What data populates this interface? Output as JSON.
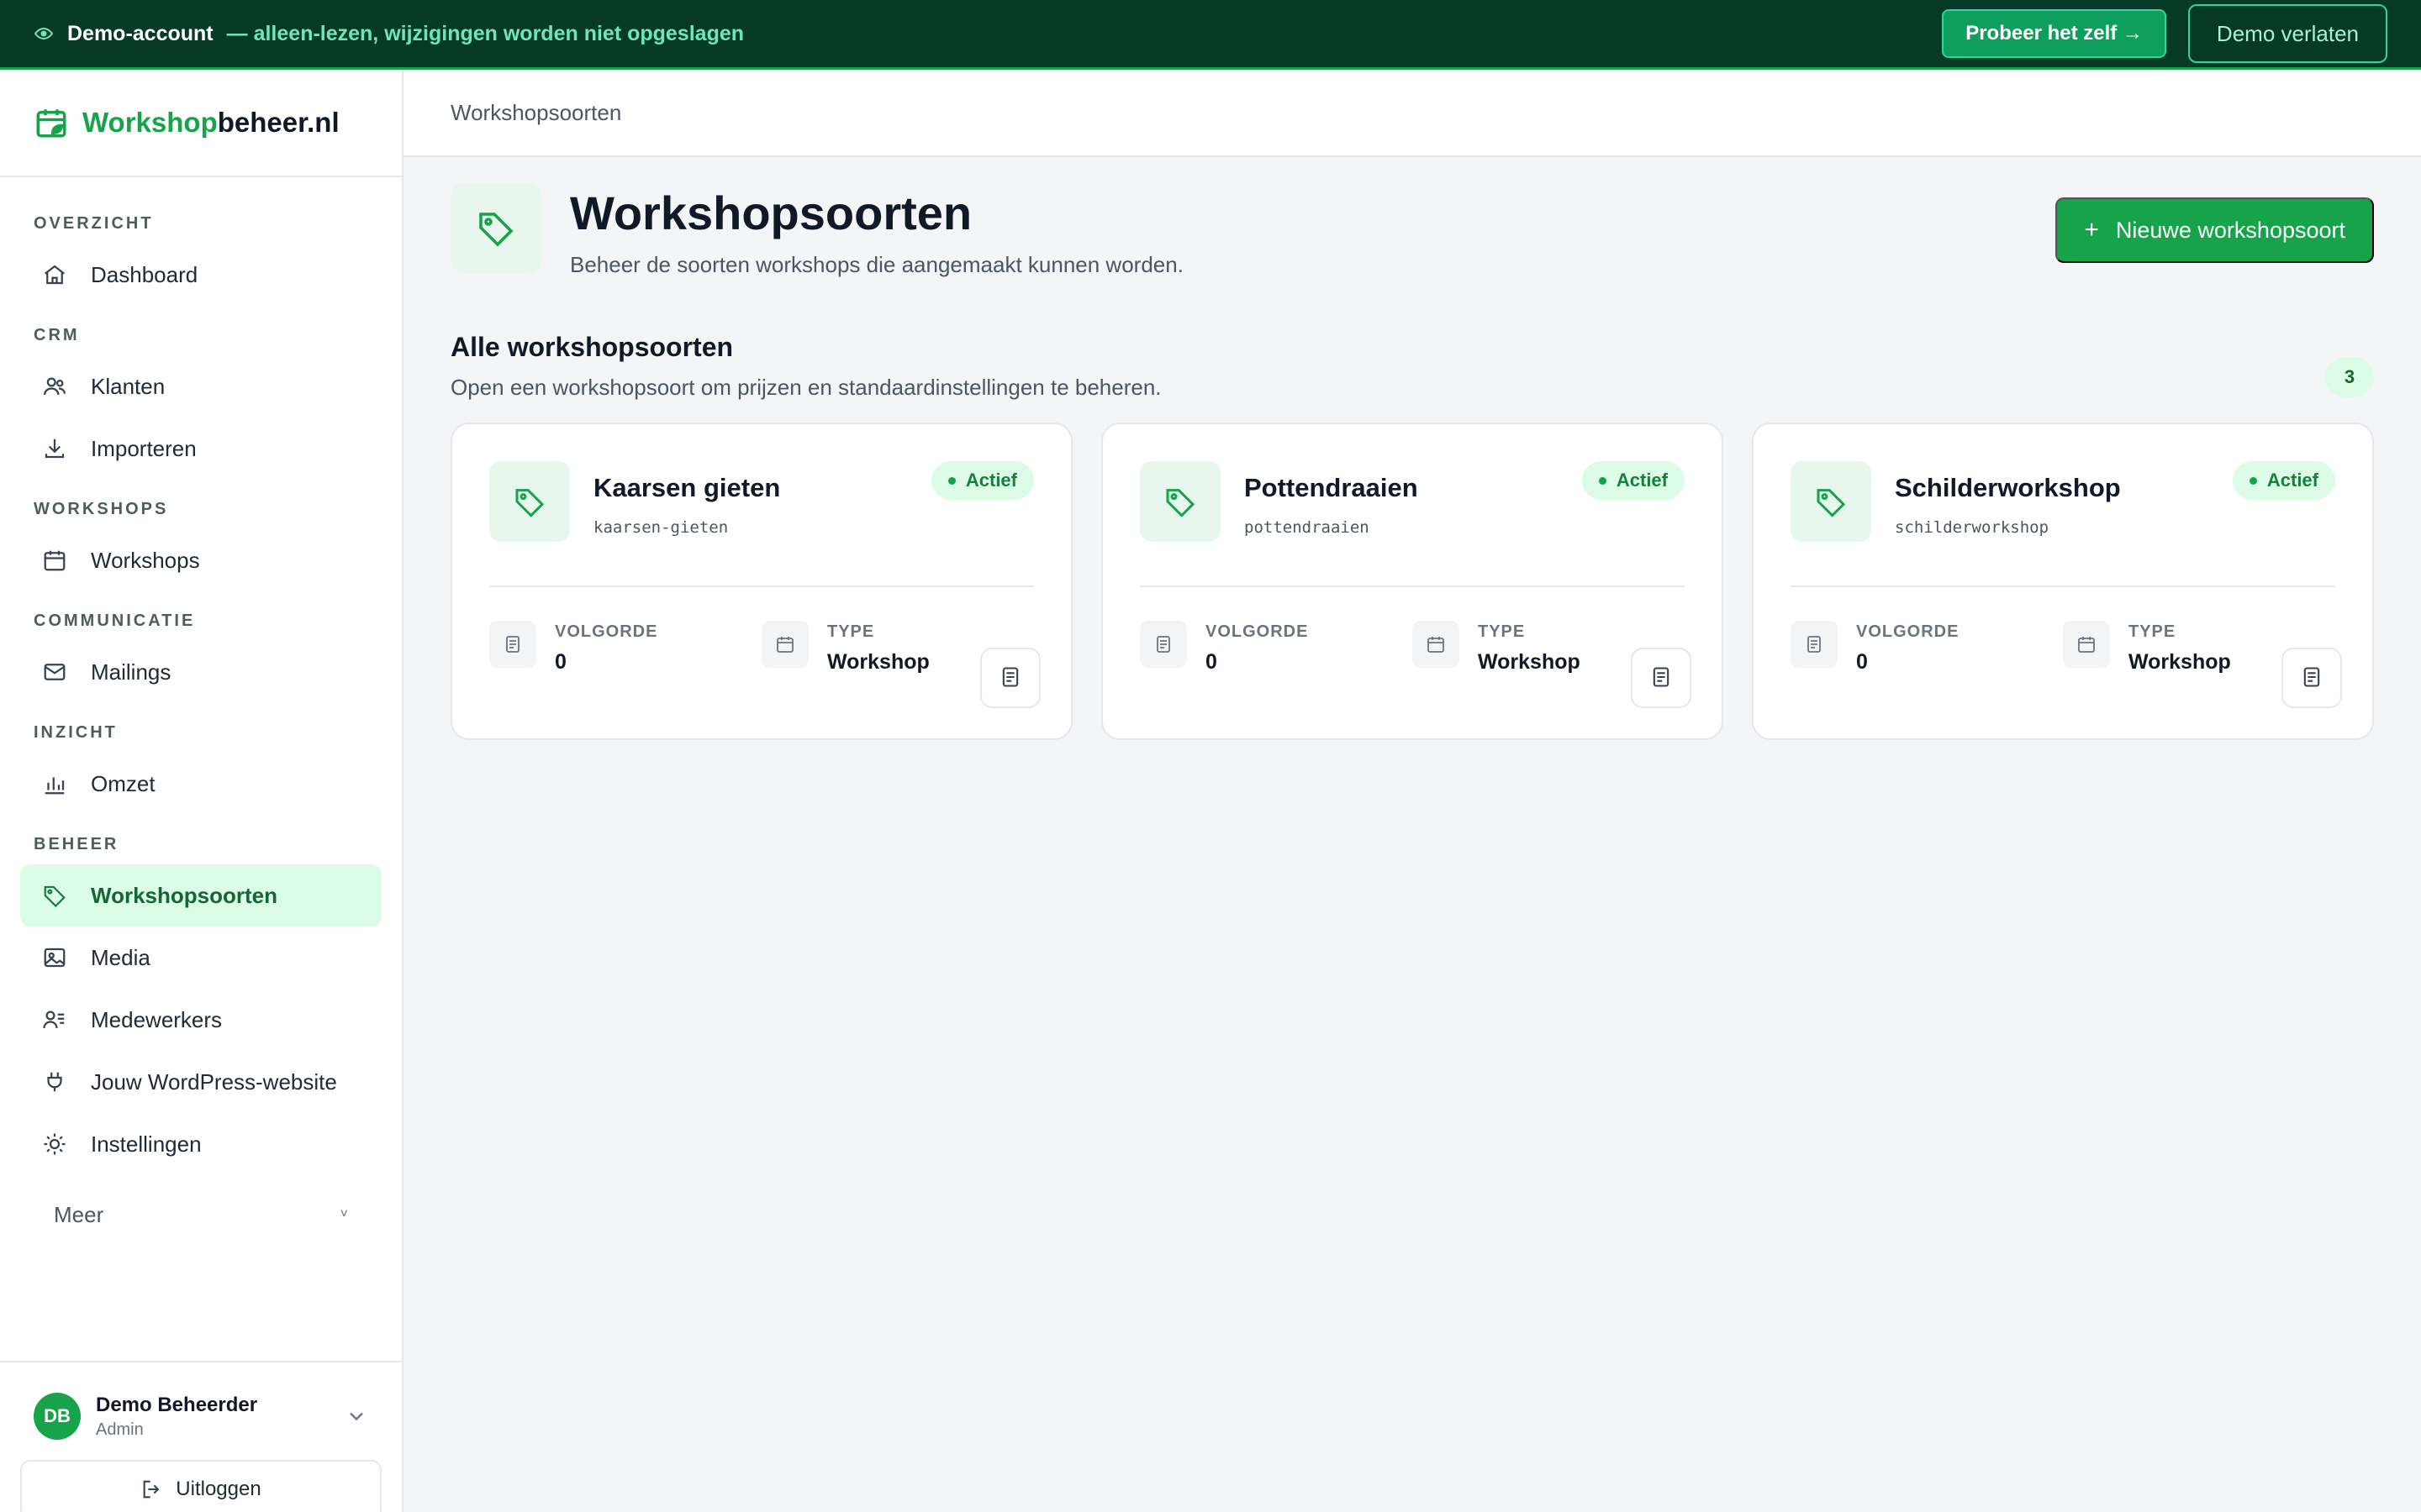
{
  "banner": {
    "account_label": "Demo-account",
    "note": "— alleen-lezen, wijzigingen worden niet opgeslagen",
    "try_button": "Probeer het zelf →",
    "exit_button": "Demo verlaten"
  },
  "brand": {
    "name_green": "Workshop",
    "name_rest": "beheer.nl"
  },
  "nav": {
    "sections": {
      "overzicht": "OVERZICHT",
      "crm": "CRM",
      "workshops": "WORKSHOPS",
      "communicatie": "COMMUNICATIE",
      "inzicht": "INZICHT",
      "beheer": "BEHEER"
    },
    "items": {
      "dashboard": "Dashboard",
      "klanten": "Klanten",
      "importeren": "Importeren",
      "workshops": "Workshops",
      "mailings": "Mailings",
      "omzet": "Omzet",
      "workshopsoorten": "Workshopsoorten",
      "media": "Media",
      "medewerkers": "Medewerkers",
      "wordpress": "Jouw WordPress-website",
      "instellingen": "Instellingen"
    },
    "more": "Meer",
    "more_chevron": "˅"
  },
  "user": {
    "initials": "DB",
    "name": "Demo Beheerder",
    "role": "Admin",
    "logout": "Uitloggen"
  },
  "topbar": {
    "breadcrumb": "Workshopsoorten"
  },
  "page": {
    "title": "Workshopsoorten",
    "subtitle": "Beheer de soorten workshops die aangemaakt kunnen worden.",
    "new_button": "Nieuwe workshopsoort",
    "new_button_plus": "+"
  },
  "section": {
    "title": "Alle workshopsoorten",
    "subtitle": "Open een workshopsoort om prijzen en standaardinstellingen te beheren.",
    "count": "3"
  },
  "cards": [
    {
      "name": "Kaarsen gieten",
      "slug": "kaarsen-gieten",
      "status": "Actief",
      "order_label": "VOLGORDE",
      "order": "0",
      "type_label": "TYPE",
      "type": "Workshop"
    },
    {
      "name": "Pottendraaien",
      "slug": "pottendraaien",
      "status": "Actief",
      "order_label": "VOLGORDE",
      "order": "0",
      "type_label": "TYPE",
      "type": "Workshop"
    },
    {
      "name": "Schilderworkshop",
      "slug": "schilderworkshop",
      "status": "Actief",
      "order_label": "VOLGORDE",
      "order": "0",
      "type_label": "TYPE",
      "type": "Workshop"
    }
  ],
  "icons": {
    "banner": "eye-icon",
    "brand": "calendar-leaf-icon",
    "dashboard": "home-icon",
    "klanten": "users-icon",
    "importeren": "download-icon",
    "workshops": "calendar-icon",
    "mailings": "mail-icon",
    "omzet": "bar-chart-icon",
    "workshopsoorten": "tag-icon",
    "media": "image-icon",
    "medewerkers": "user-list-icon",
    "wordpress": "plug-icon",
    "instellingen": "sun-gear-icon",
    "logout": "logout-icon",
    "card_action": "document-icon"
  },
  "colors": {
    "accent": "#16a34a",
    "banner_bg": "#063a26",
    "active_bg": "#dcfce7",
    "banner_text": "#6ee7b7"
  }
}
